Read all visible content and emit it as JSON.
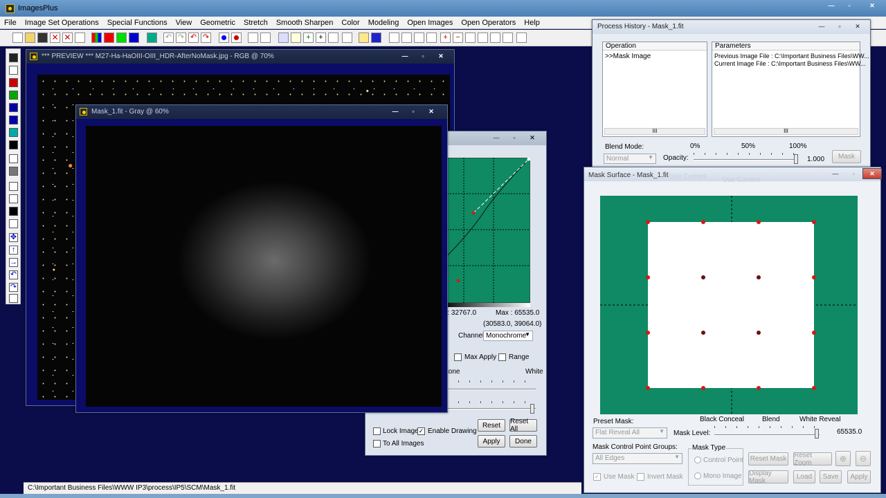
{
  "app": {
    "title": "ImagesPlus"
  },
  "menu": [
    "File",
    "Image Set Operations",
    "Special Functions",
    "View",
    "Geometric",
    "Stretch",
    "Smooth Sharpen",
    "Color",
    "Modeling",
    "Open Images",
    "Open Operators",
    "Help"
  ],
  "preview_window": {
    "title": "*** PREVIEW *** M27-Ha-HaOIII-OIII_HDR-AfterNoMask.jpg - RGB @ 70%"
  },
  "mask_window": {
    "title": "Mask_1.fit - Gray @ 60%"
  },
  "curves_window": {
    "info_range": "d : 32767.0",
    "info_max": "Max : 65535.0",
    "coords": "(30583.0, 39064.0)",
    "channel_label": "Channel:",
    "channel_value": "Monochrome",
    "max_apply_label": "Max Apply",
    "range_label": "Range",
    "tone_label": "ctone",
    "white_label": "White",
    "lock_image_label": "Lock Image",
    "enable_drawing_label": "Enable Drawing",
    "to_all_images_label": "To All Images",
    "reset_label": "Reset",
    "reset_all_label": "Reset All",
    "apply_label": "Apply",
    "done_label": "Done"
  },
  "process_history": {
    "title": "Process History - Mask_1.fit",
    "operation_header": "Operation",
    "operation_item": ">>Mask Image",
    "parameters_header": "Parameters",
    "param_lines": [
      "Previous Image File : C:\\Important Business Files\\WW...",
      "Current Image File : C:\\Important Business Files\\WW..."
    ],
    "scroll_grip": "III",
    "blend_mode_label": "Blend Mode:",
    "blend_mode_value": "Normal",
    "pct_0": "0%",
    "pct_50": "50%",
    "pct_100": "100%",
    "opacity_label": "Opacity:",
    "opacity_value": "1.000",
    "mask_label": "Mask"
  },
  "mask_surface": {
    "title": "Mask Surface - Mask_1.fit",
    "ghost_text_1": "Use Current",
    "ghost_text_2": "Use Current",
    "preset_mask_label": "Preset Mask:",
    "preset_mask_value": "Flat Reveal All",
    "black_conceal_label": "Black Conceal",
    "blend_label": "Blend",
    "white_reveal_label": "White Reveal",
    "mask_level_label": "Mask Level:",
    "mask_level_value": "65535.0",
    "control_groups_label": "Mask Control Point Groups:",
    "control_groups_value": "All Edges",
    "mask_type_label": "Mask Type",
    "control_point_label": "Control Point",
    "mono_image_label": "Mono Image",
    "use_mask_label": "Use Mask",
    "invert_mask_label": "Invert Mask",
    "reset_mask_label": "Reset Mask",
    "reset_zoom_label": "Reset Zoom",
    "display_mask_label": "Display Mask",
    "load_label": "Load",
    "save_label": "Save",
    "apply_label": "Apply",
    "colors": {
      "surface_bg": "#108a64",
      "mask_fill": "#ffffff",
      "control_point_edge": "#d21a1a",
      "control_point_inner": "#6a1010"
    }
  },
  "status": {
    "path": "C:\\Important Business Files\\WWW IP3\\process\\IP5\\SCM\\Mask_1.fit"
  },
  "icons": [
    "new-icon",
    "open-icon",
    "save-icon",
    "close-icon",
    "zoom-in-icon",
    "zoom-out-icon",
    "move-icon",
    "pencil-icon"
  ]
}
